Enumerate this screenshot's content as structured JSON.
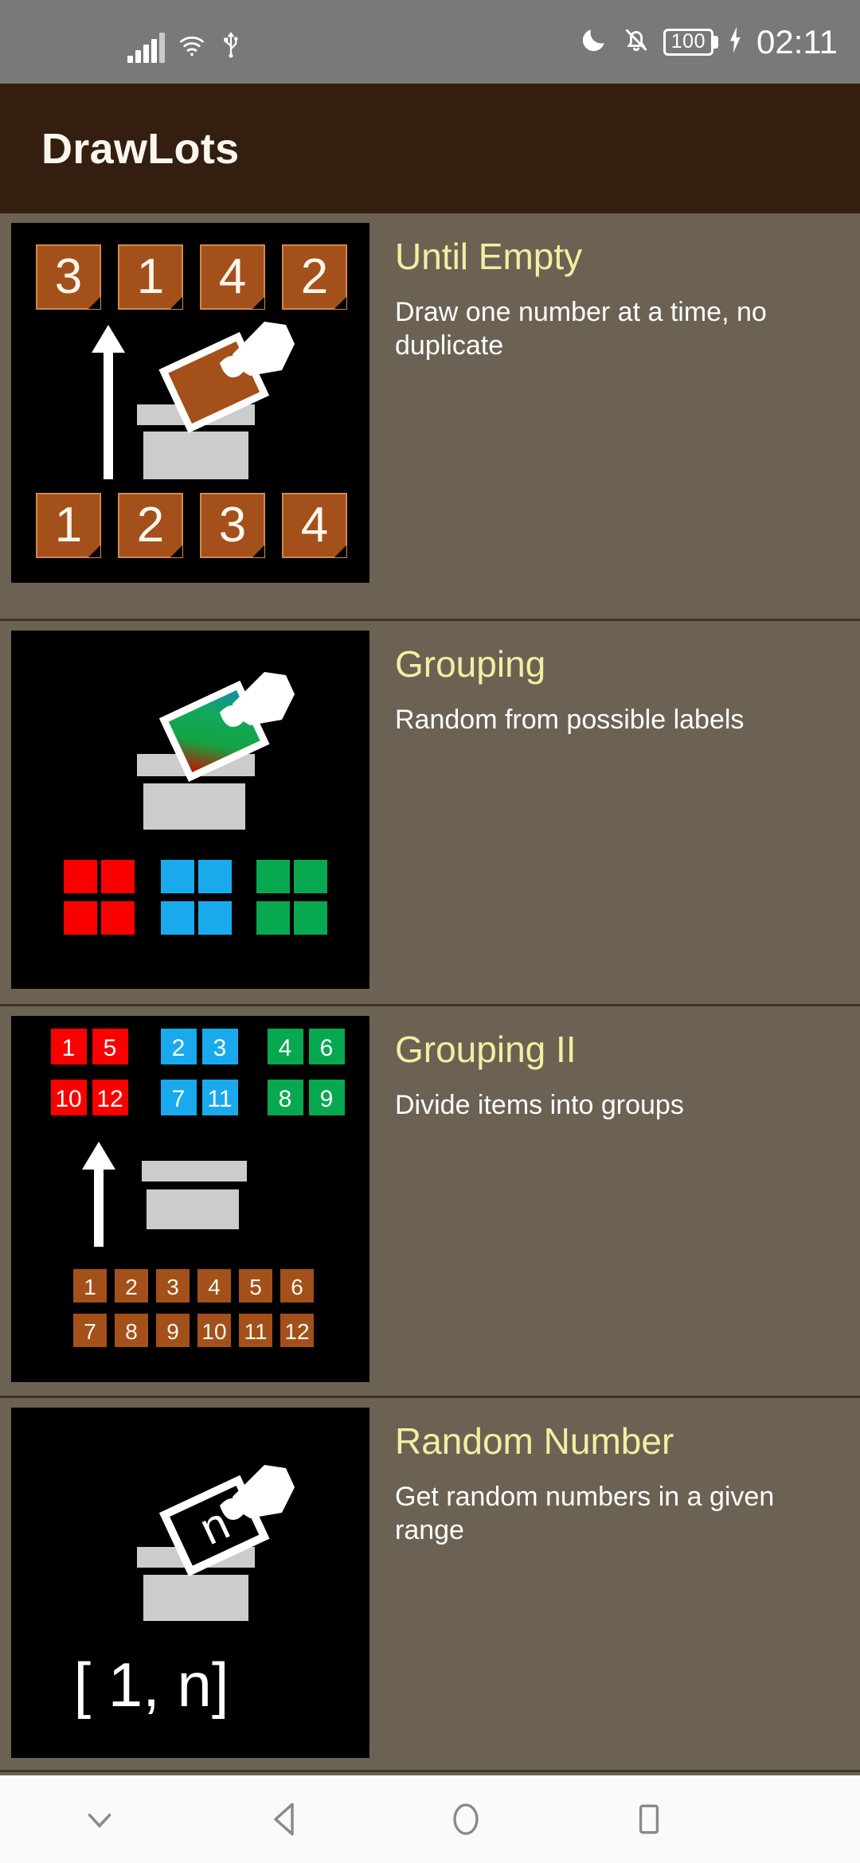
{
  "statusbar": {
    "signal_icon": "cellular-signal-icon",
    "wifi_icon": "wifi-icon",
    "usb_icon": "usb-icon",
    "dnd_icon": "moon-do-not-disturb-icon",
    "mute_icon": "bell-off-icon",
    "battery_level": "100",
    "charging_icon": "lightning-bolt-icon",
    "time": "02:11"
  },
  "appbar": {
    "title": "DrawLots"
  },
  "list": {
    "items": [
      {
        "title": "Until Empty",
        "description": "Draw one number at a time, no duplicate",
        "icon_name": "until-empty-icon",
        "icon": {
          "type": "numbers-ballot",
          "top_numbers": [
            "3",
            "1",
            "4",
            "2"
          ],
          "bottom_numbers": [
            "1",
            "2",
            "3",
            "4"
          ],
          "arrow": "up-arrow",
          "card_color": "#a3501b"
        }
      },
      {
        "title": "Grouping",
        "description": "Random from possible labels",
        "icon_name": "grouping-icon",
        "icon": {
          "type": "color-groups",
          "groups": [
            {
              "color": "#fb0000",
              "count": 4
            },
            {
              "color": "#19aaee",
              "count": 4
            },
            {
              "color": "#08a850",
              "count": 4
            }
          ],
          "card_color": "gradient"
        }
      },
      {
        "title": "Grouping II",
        "description": "Divide items into groups",
        "icon_name": "grouping-two-icon",
        "icon": {
          "type": "numbered-color-groups",
          "groups": [
            {
              "color": "#fb0000",
              "values": [
                "1",
                "5",
                "10",
                "12"
              ]
            },
            {
              "color": "#19aaee",
              "values": [
                "2",
                "3",
                "7",
                "11"
              ]
            },
            {
              "color": "#08a850",
              "values": [
                "4",
                "6",
                "8",
                "9"
              ]
            }
          ],
          "arrow": "up-arrow",
          "pool": [
            "1",
            "2",
            "3",
            "4",
            "5",
            "6",
            "7",
            "8",
            "9",
            "10",
            "11",
            "12"
          ]
        }
      },
      {
        "title": "Random Number",
        "description": "Get random numbers in a given range",
        "icon_name": "random-number-icon",
        "icon": {
          "type": "range-ballot",
          "card_label": "n",
          "range_label": "[ 1, n]"
        }
      }
    ]
  },
  "navbar": {
    "hide_keyboard_icon": "chevron-down-icon",
    "back_icon": "back-triangle-icon",
    "home_icon": "home-circle-icon",
    "recents_icon": "recents-square-icon"
  },
  "colors": {
    "app_bar": "#331e0f",
    "background": "#6b6254",
    "title_accent": "#f5eda0",
    "card_brown": "#a3501b",
    "thumb_bg": "#000000"
  }
}
